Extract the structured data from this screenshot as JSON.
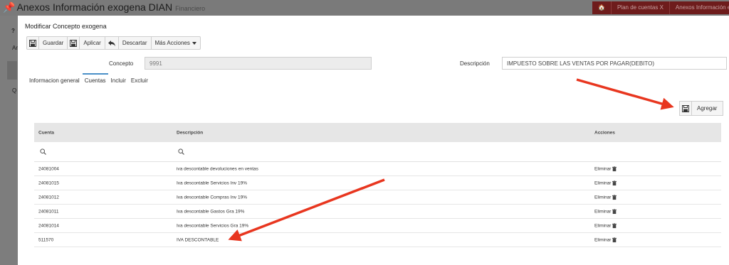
{
  "app": {
    "title": "Anexos Información exogena DIAN",
    "subtitle": "Financiero",
    "breadcrumb": [
      "🏠",
      "Plan de cuentas X",
      "Anexos Información exogena"
    ],
    "side_labels": [
      "?",
      "An",
      "Q"
    ]
  },
  "modal": {
    "title": "Modificar Concepto exogena",
    "toolbar": {
      "save_label": "Guardar",
      "apply_label": "Aplicar",
      "discard_label": "Descartar",
      "more_label": "Más Acciones"
    },
    "form": {
      "concepto_label": "Concepto",
      "concepto_value": "9991",
      "descripcion_label": "Descripción",
      "descripcion_value": "IMPUESTO SOBRE LAS VENTAS POR PAGAR(DEBITO)"
    },
    "tabs": [
      {
        "label": "Informacion general",
        "active": false
      },
      {
        "label": "Cuentas",
        "active": true
      },
      {
        "label": "Incluir",
        "active": false
      },
      {
        "label": "Excluir",
        "active": false
      }
    ],
    "add_label": "Agregar",
    "table": {
      "headers": [
        "Cuenta",
        "Descripción",
        "Acciones"
      ],
      "rows": [
        {
          "cuenta": "24081004",
          "descripcion": "iva descontable devoluciones en ventas",
          "accion": "Eliminar"
        },
        {
          "cuenta": "24081015",
          "descripcion": "Iva descontable Servicios Inv 19%",
          "accion": "Eliminar"
        },
        {
          "cuenta": "24081012",
          "descripcion": "Iva descontable Compras Inv 19%",
          "accion": "Eliminar"
        },
        {
          "cuenta": "24081011",
          "descripcion": "Iva descontable Gastos Gra 19%",
          "accion": "Eliminar"
        },
        {
          "cuenta": "24081014",
          "descripcion": "Iva descontable Servicios Gra 19%",
          "accion": "Eliminar"
        },
        {
          "cuenta": "511570",
          "descripcion": "IVA DESCONTABLE",
          "accion": "Eliminar"
        }
      ]
    }
  },
  "colors": {
    "annotation_arrow": "#e8361f",
    "tab_active": "#4a90c8",
    "breadcrumb_bg": "#6e1c1c"
  }
}
